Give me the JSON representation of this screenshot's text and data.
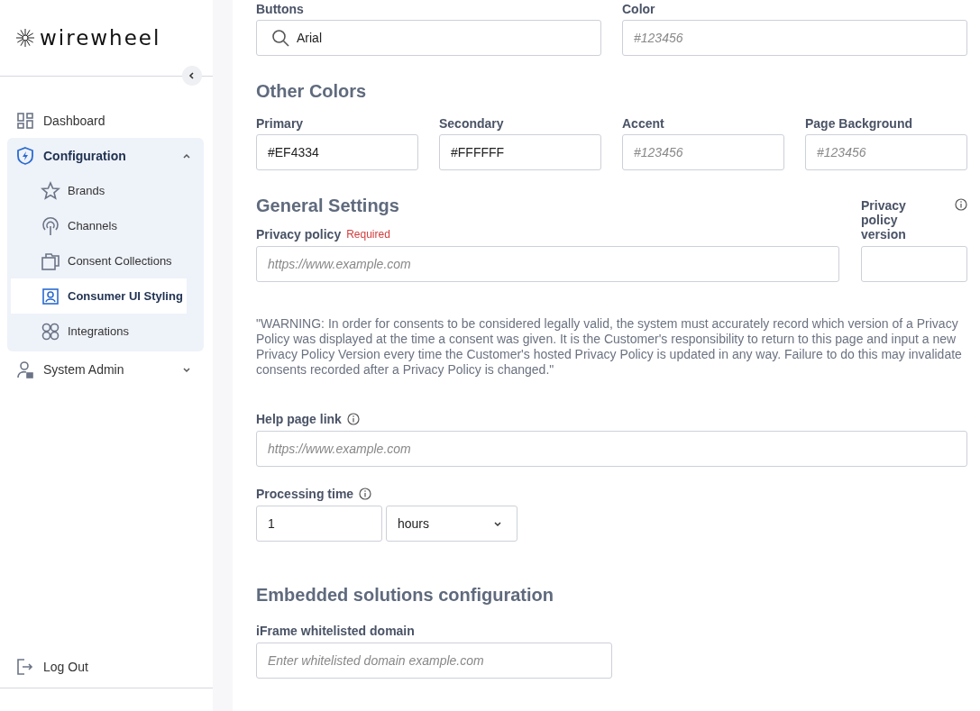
{
  "sidebar": {
    "logo": "wirewheel",
    "items": [
      {
        "label": "Dashboard",
        "selected": false
      },
      {
        "label": "Configuration",
        "selected": false,
        "expanded": true,
        "children": [
          {
            "label": "Brands",
            "selected": false
          },
          {
            "label": "Channels",
            "selected": false
          },
          {
            "label": "Consent Collections",
            "selected": false
          },
          {
            "label": "Consumer UI Styling",
            "selected": true
          },
          {
            "label": "Integrations",
            "selected": false
          }
        ]
      },
      {
        "label": "System Admin",
        "selected": false,
        "expanded": false
      }
    ],
    "logout": "Log Out"
  },
  "font_row": [
    {
      "label": "Buttons",
      "kind": "search",
      "value": "Arial"
    },
    {
      "label": "Color",
      "kind": "text",
      "placeholder": "#123456"
    }
  ],
  "other_colors": {
    "title": "Other Colors",
    "fields": [
      {
        "label": "Primary",
        "value": "#EF4334"
      },
      {
        "label": "Secondary",
        "value": "#FFFFFF"
      },
      {
        "label": "Accent",
        "placeholder": "#123456"
      },
      {
        "label": "Page Background",
        "placeholder": "#123456"
      }
    ]
  },
  "general": {
    "title": "General Settings",
    "privacy_policy": {
      "label": "Privacy policy",
      "required": "Required",
      "placeholder": "https://www.example.com"
    },
    "version": {
      "label": "Privacy policy version"
    },
    "warning": "\"WARNING: In order for consents to be considered legally valid, the system must accurately record which version of a Privacy Policy was displayed at the time a consent was given. It is the Customer's responsibility to return to this page and input a new Privacy Policy Version every time the Customer's hosted Privacy Policy is updated in any way. Failure to do this may invalidate consents recorded after a Privacy Policy is changed.\"",
    "help": {
      "label": "Help page link",
      "placeholder": "https://www.example.com"
    },
    "processing": {
      "label": "Processing time",
      "value": "1",
      "unit": "hours"
    }
  },
  "embedded": {
    "title": "Embedded solutions configuration",
    "label": "iFrame whitelisted domain",
    "placeholder": "Enter whitelisted domain example.com"
  }
}
